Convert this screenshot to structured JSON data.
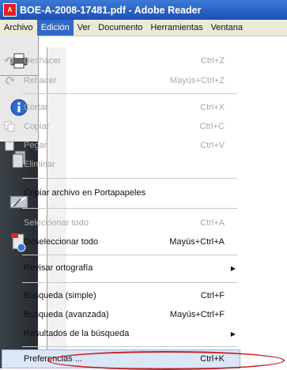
{
  "window": {
    "title": "BOE-A-2008-17481.pdf - Adobe Reader",
    "icon": "pdf-icon"
  },
  "menubar": [
    "Archivo",
    "Edición",
    "Ver",
    "Documento",
    "Herramientas",
    "Ventana"
  ],
  "menu": {
    "items": [
      {
        "label": "Deshacer",
        "shortcut": "Ctrl+Z",
        "enabled": false,
        "icon": "undo-icon"
      },
      {
        "label": "Rehacer",
        "shortcut": "Mayús+Ctrl+Z",
        "enabled": false,
        "icon": "redo-icon"
      },
      {
        "label": "Cortar",
        "shortcut": "Ctrl+X",
        "enabled": false
      },
      {
        "label": "Copiar",
        "shortcut": "Ctrl+C",
        "enabled": false,
        "icon": "copy-icon"
      },
      {
        "label": "Pegar",
        "shortcut": "Ctrl+V",
        "enabled": false,
        "icon": "paste-icon"
      },
      {
        "label": "Eliminar",
        "shortcut": "",
        "enabled": false
      },
      {
        "label": "Copiar archivo en Portapapeles",
        "shortcut": "",
        "enabled": true
      },
      {
        "label": "Seleccionar todo",
        "shortcut": "Ctrl+A",
        "enabled": false
      },
      {
        "label": "Deseleccionar todo",
        "shortcut": "Mayús+Ctrl+A",
        "enabled": true
      },
      {
        "label": "Revisar ortografía",
        "shortcut": "",
        "enabled": true,
        "submenu": true
      },
      {
        "label": "Búsqueda (simple)",
        "shortcut": "Ctrl+F",
        "enabled": true
      },
      {
        "label": "Búsqueda (avanzada)",
        "shortcut": "Mayús+Ctrl+F",
        "enabled": true
      },
      {
        "label": "Resultados de la búsqueda",
        "shortcut": "",
        "enabled": true,
        "submenu": true
      },
      {
        "label": "Preferencias ...",
        "shortcut": "Ctrl+K",
        "enabled": true,
        "highlighted": true
      }
    ]
  },
  "leftpanel_icons": [
    "print-icon",
    "info-icon",
    "pages-icon",
    "signatures-icon",
    "attachments-icon"
  ],
  "colors": {
    "titlebar": "#1d4fb7",
    "highlight_circle": "#c62020",
    "active_menu": "#316ac5"
  }
}
